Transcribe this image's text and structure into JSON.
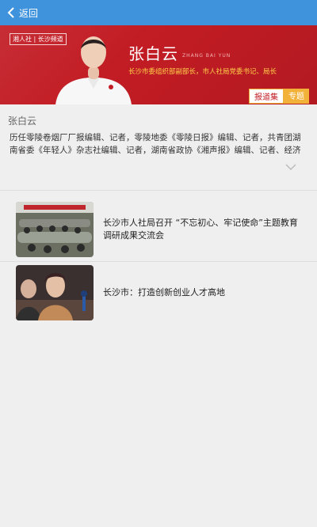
{
  "header": {
    "back_label": "返回"
  },
  "banner": {
    "tag": "湘人社 | 长沙频道",
    "name": "张白云",
    "name_pinyin": "ZHANG BAI YUN",
    "title": "长沙市委组织部副部长，市人社局党委书记、局长",
    "tag_report": "报道集",
    "tag_special": "专题"
  },
  "bio": {
    "name": "张白云",
    "text": "历任零陵卷烟厂厂报编辑、记者，零陵地委《零陵日报》编辑、记者，共青团湖南省委《年轻人》杂志社编辑、记者，湖南省政协《湘声报》编辑、记者、经济"
  },
  "news": [
    {
      "title": "长沙市人社局召开 “不忘初心、牢记使命”主题教育调研成果交流会"
    },
    {
      "title": "长沙市：打造创新创业人才高地"
    }
  ],
  "colors": {
    "accent": "#3f93dc",
    "banner_red": "#c21c24",
    "gold": "#f2b23a"
  }
}
